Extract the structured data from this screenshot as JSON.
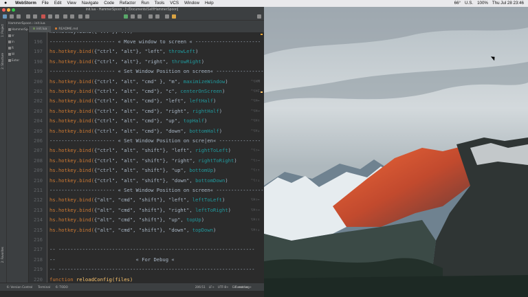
{
  "menubar": {
    "apple": "",
    "app": "WebStorm",
    "menus": [
      "File",
      "Edit",
      "View",
      "Navigate",
      "Code",
      "Refactor",
      "Run",
      "Tools",
      "VCS",
      "Window",
      "Help"
    ],
    "status": [
      "66°",
      "U.S.",
      "100%",
      "Thu Jul 28  23:46"
    ]
  },
  "ide": {
    "title": "init.lua - HammerSpoon - [~/Documents/Self/HammerSpoon]",
    "nav_path": "HammerSpoon  ›  init.lua",
    "tabs": [
      {
        "label": "init.lua",
        "active": true,
        "icon_color": "#6a8759"
      },
      {
        "label": "README.md",
        "active": false,
        "icon_color": "#cc7832"
      }
    ],
    "project_tree": [
      "HammerSpoon",
      "sr",
      "in",
      "R",
      "W",
      "Exter"
    ],
    "strip_labels": [
      "1: Project",
      "2: Structure",
      "2: Favorites"
    ]
  },
  "editor": {
    "top_partial": "hs.hotkey.bind({\"...\"}, ...)",
    "lines": [
      {
        "num": "196",
        "type": "comment",
        "text": "---------------------- « Move window to screen « ----------------------"
      },
      {
        "num": "197",
        "type": "bind",
        "mods": "{\"ctrl\", \"alt\"}",
        "key": "\"left\"",
        "fn": "throwLeft",
        "hint": ""
      },
      {
        "num": "198",
        "type": "bind",
        "mods": "{\"ctrl\", \"alt\"}",
        "key": "\"right\"",
        "fn": "throwRight",
        "hint": ""
      },
      {
        "num": "199",
        "type": "comment",
        "text": "---------------------- « Set Window Position on screen« ----------------"
      },
      {
        "num": "200",
        "type": "bind",
        "mods": "{\"ctrl\", \"alt\", \"cmd\" }",
        "key": "\"m\"",
        "fn": "maximizeWindow",
        "hint": "⌃⌥⌘M"
      },
      {
        "num": "201",
        "type": "bind",
        "mods": "{\"ctrl\", \"alt\", \"cmd\"}",
        "key": "\"c\"",
        "fn": "centerOnScreen",
        "hint": "⌃⌥⌘C"
      },
      {
        "num": "202",
        "type": "bind",
        "mods": "{\"ctrl\", \"alt\", \"cmd\"}",
        "key": "\"left\"",
        "fn": "leftHalf",
        "hint": "⌃⌥⌘←"
      },
      {
        "num": "203",
        "type": "bind",
        "mods": "{\"ctrl\", \"alt\", \"cmd\"}",
        "key": "\"right\"",
        "fn": "rightHalf",
        "hint": "⌃⌥⌘→"
      },
      {
        "num": "204",
        "type": "bind",
        "mods": "{\"ctrl\", \"alt\", \"cmd\"}",
        "key": "\"up\"",
        "fn": "topHalf",
        "hint": "⌃⌥⌘↑"
      },
      {
        "num": "205",
        "type": "bind",
        "mods": "{\"ctrl\", \"alt\", \"cmd\"}",
        "key": "\"down\"",
        "fn": "bottomHalf",
        "hint": "⌃⌥⌘↓"
      },
      {
        "num": "206",
        "type": "comment",
        "text": "---------------------- « Set Window Position on scre|en« --------------"
      },
      {
        "num": "207",
        "type": "bind",
        "mods": "{\"ctrl\", \"alt\", \"shift\"}",
        "key": "\"left\"",
        "fn": "rightToLeft",
        "hint": "⌃⌥⇧←"
      },
      {
        "num": "208",
        "type": "bind",
        "mods": "{\"ctrl\", \"alt\", \"shift\"}",
        "key": "\"right\"",
        "fn": "rightToRight",
        "hint": "⌃⌥⇧→"
      },
      {
        "num": "209",
        "type": "bind",
        "mods": "{\"ctrl\", \"alt\", \"shift\"}",
        "key": "\"up\"",
        "fn": "bottomUp",
        "hint": "⌃⌥⇧↑"
      },
      {
        "num": "210",
        "type": "bind",
        "mods": "{\"ctrl\", \"alt\", \"shift\"}",
        "key": "\"down\"",
        "fn": "bottomDown",
        "hint": "⌃⌥⇧↓"
      },
      {
        "num": "211",
        "type": "comment",
        "text": "---------------------- « Set Window Position on screen« ----------------"
      },
      {
        "num": "212",
        "type": "bind",
        "mods": "{\"alt\", \"cmd\", \"shift\"}",
        "key": "\"left\"",
        "fn": "leftToLeft",
        "hint": "⌥⌘⇧←"
      },
      {
        "num": "213",
        "type": "bind",
        "mods": "{\"alt\", \"cmd\", \"shift\"}",
        "key": "\"right\"",
        "fn": "leftToRight",
        "hint": "⌥⌘⇧→"
      },
      {
        "num": "214",
        "type": "bind",
        "mods": "{\"alt\", \"cmd\", \"shift\"}",
        "key": "\"up\"",
        "fn": "topUp",
        "hint": "⌥⌘⇧↑"
      },
      {
        "num": "215",
        "type": "bind",
        "mods": "{\"alt\", \"cmd\", \"shift\"}",
        "key": "\"down\"",
        "fn": "topDown",
        "hint": "⌥⌘⇧↓"
      },
      {
        "num": "216",
        "type": "blank",
        "text": ""
      },
      {
        "num": "217",
        "type": "comment",
        "text": "-- ------------------------------------------------------------------"
      },
      {
        "num": "218",
        "type": "comment",
        "text": "--                           « For Debug «"
      },
      {
        "num": "219",
        "type": "comment",
        "text": "-- ------------------------------------------------------------------"
      },
      {
        "num": "220",
        "type": "func",
        "text": "reloadConfig(files)"
      }
    ]
  },
  "statusbar": {
    "left": [
      "6: Version Control",
      "Terminal",
      "6: TODO"
    ],
    "event_log": "Event Log",
    "right": [
      "206:51",
      "LF÷",
      "UTF-8÷",
      "Git: master ÷"
    ]
  }
}
